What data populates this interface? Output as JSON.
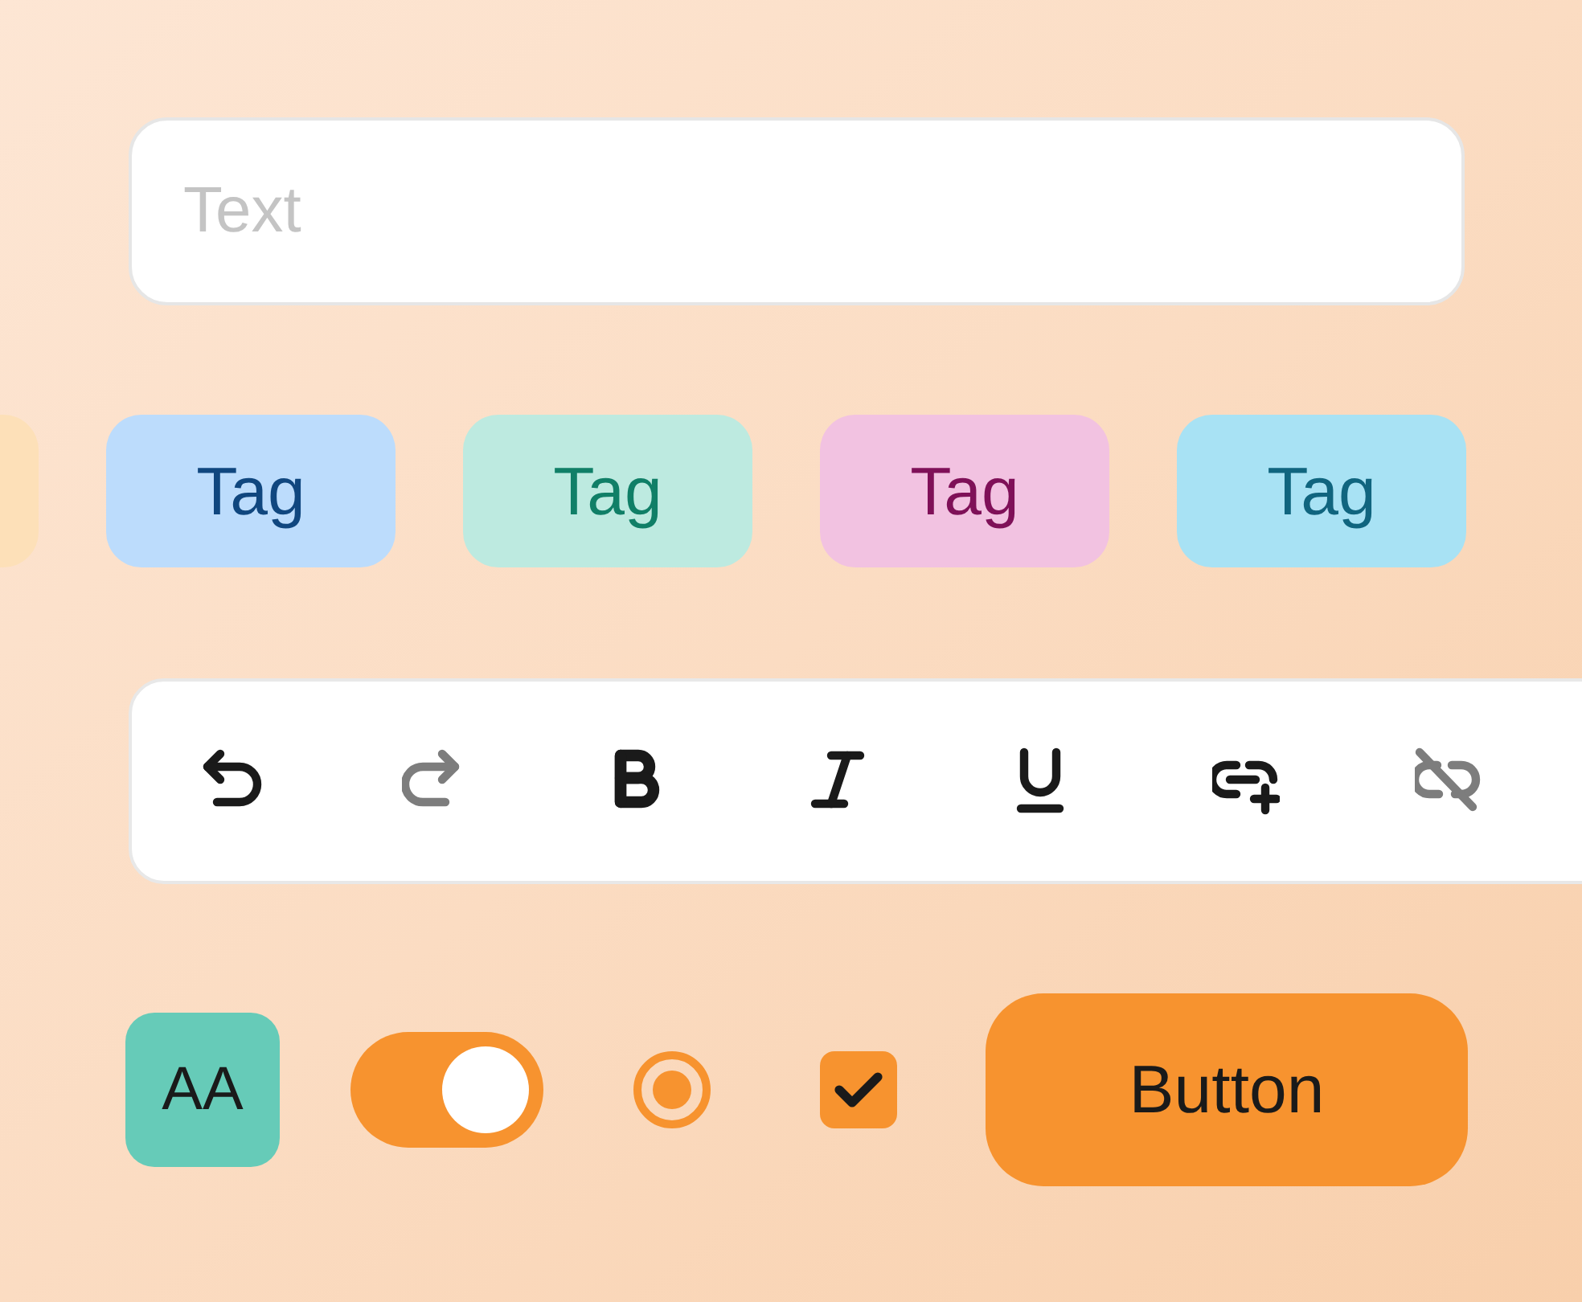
{
  "text_field": {
    "placeholder": "Text"
  },
  "tags": [
    {
      "color": "#fde0b8"
    },
    {
      "label": "Tag",
      "color": "#bcdcfc"
    },
    {
      "label": "Tag",
      "color": "#bdeae0"
    },
    {
      "label": "Tag",
      "color": "#f2c2e1"
    },
    {
      "label": "Tag",
      "color": "#a8e2f4"
    }
  ],
  "toolbar": {
    "buttons": [
      {
        "kind": "undo",
        "disabled": false
      },
      {
        "kind": "redo",
        "disabled": true
      },
      {
        "kind": "bold",
        "disabled": false
      },
      {
        "kind": "italic",
        "disabled": false
      },
      {
        "kind": "underline",
        "disabled": false
      },
      {
        "kind": "link",
        "disabled": false
      },
      {
        "kind": "unlink",
        "disabled": true
      }
    ]
  },
  "controls": [
    {
      "kind": "text_style",
      "label": "AA"
    },
    {
      "kind": "toggle",
      "on": true
    },
    {
      "kind": "radio",
      "selected": true
    },
    {
      "kind": "checkbox",
      "checked": true
    },
    {
      "kind": "button",
      "label": "Button"
    }
  ]
}
